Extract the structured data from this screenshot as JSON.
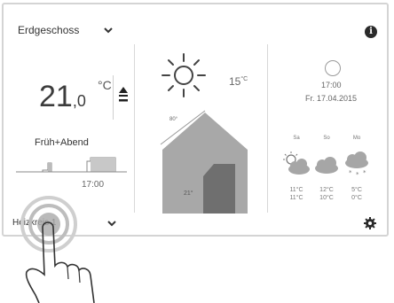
{
  "header": {
    "room": "Erdgeschoss",
    "info_icon": "info-icon"
  },
  "left_panel": {
    "temperature_whole": "21",
    "temperature_decimal": ",0",
    "temperature_unit": "°C",
    "mode": "Früh+Abend",
    "schedule_time": "17:00"
  },
  "middle_panel": {
    "weather_icon": "sun-icon",
    "outside_temp": "15",
    "outside_unit": "°C",
    "house_label_roof": "80°",
    "house_label_floor": "21°"
  },
  "right_panel": {
    "time": "17:00",
    "date": "Fr. 17.04.2015",
    "forecast": [
      {
        "day": "Sa",
        "icon": "partly-cloudy-icon",
        "high": "11°C",
        "low": "11°C"
      },
      {
        "day": "So",
        "icon": "cloud-icon",
        "high": "12°C",
        "low": "10°C"
      },
      {
        "day": "Mo",
        "icon": "snow-cloud-icon",
        "high": "5°C",
        "low": "0°C"
      }
    ]
  },
  "footer": {
    "profile": "Heizkreis 1",
    "settings_icon": "gear-icon"
  },
  "colors": {
    "house_fill": "#a8a8a8",
    "house_door": "#6f6f6f",
    "text_dark": "#3c3c3c"
  }
}
